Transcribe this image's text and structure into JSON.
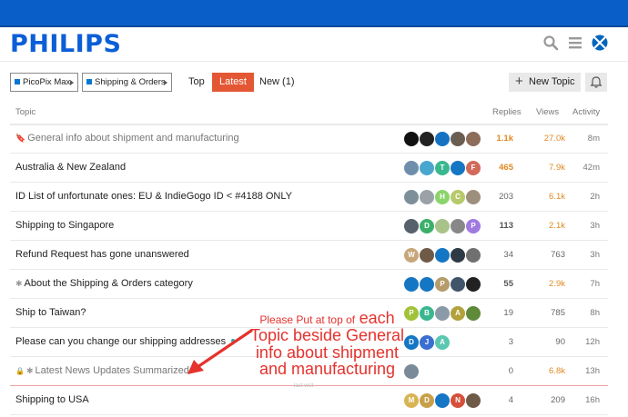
{
  "brand": {
    "logo": "PHILIPS",
    "topbar_color": "#0a5ec7",
    "accent": "#e45735"
  },
  "header": {
    "icons": [
      "search-icon",
      "menu-icon",
      "flag-icon"
    ]
  },
  "nav": {
    "crumbs": [
      {
        "label": "PicoPix Max"
      },
      {
        "label": "Shipping & Orders"
      }
    ],
    "tabs": [
      {
        "label": "Top"
      },
      {
        "label": "Latest",
        "active": true
      },
      {
        "label": "New (1)"
      }
    ],
    "new_topic": "New Topic"
  },
  "columns": {
    "topic": "Topic",
    "replies": "Replies",
    "views": "Views",
    "activity": "Activity"
  },
  "topics": [
    {
      "title": "General info about shipment and manufacturing",
      "pinned": true,
      "replies": "1.1k",
      "views": "27.0k",
      "activity": "8m",
      "avatars": [
        {
          "c": "#111111",
          "t": ""
        },
        {
          "c": "#222222",
          "t": ""
        },
        {
          "c": "#1572c2",
          "t": ""
        },
        {
          "c": "#6a5d52",
          "t": ""
        },
        {
          "c": "#8b6d5a",
          "t": ""
        }
      ]
    },
    {
      "title": "Australia & New Zealand",
      "replies": "465",
      "views": "7.9k",
      "activity": "42m",
      "avatars": [
        {
          "c": "#6f8eab",
          "t": ""
        },
        {
          "c": "#49a7cf",
          "t": ""
        },
        {
          "c": "#3ab78e",
          "t": "T"
        },
        {
          "c": "#1576c4",
          "t": ""
        },
        {
          "c": "#d16a5a",
          "t": "F"
        }
      ]
    },
    {
      "title": "ID List of unfortunate ones: EU & IndieGogo ID < #4188 ONLY",
      "replies": "203",
      "views": "6.1k",
      "activity": "2h",
      "avatars": [
        {
          "c": "#7d8f99",
          "t": ""
        },
        {
          "c": "#9aa2a8",
          "t": ""
        },
        {
          "c": "#8bd46c",
          "t": "H"
        },
        {
          "c": "#b7c96a",
          "t": "C"
        },
        {
          "c": "#9e8f7d",
          "t": ""
        }
      ]
    },
    {
      "title": "Shipping to Singapore",
      "replies": "113",
      "views": "2.1k",
      "activity": "3h",
      "avatars": [
        {
          "c": "#56616b",
          "t": ""
        },
        {
          "c": "#3cb06b",
          "t": "D"
        },
        {
          "c": "#a8c38a",
          "t": ""
        },
        {
          "c": "#888888",
          "t": ""
        },
        {
          "c": "#a07ae0",
          "t": "P"
        }
      ]
    },
    {
      "title": "Refund Request has gone unanswered",
      "replies": "34",
      "views": "763",
      "activity": "3h",
      "avatars": [
        {
          "c": "#c7a77a",
          "t": "W"
        },
        {
          "c": "#6f5a48",
          "t": ""
        },
        {
          "c": "#1576c4",
          "t": ""
        },
        {
          "c": "#2e3a46",
          "t": ""
        },
        {
          "c": "#707070",
          "t": ""
        }
      ]
    },
    {
      "title": "About the Shipping & Orders category",
      "pinned": true,
      "replies": "55",
      "views": "2.9k",
      "activity": "7h",
      "avatars": [
        {
          "c": "#1576c4",
          "t": ""
        },
        {
          "c": "#1576c4",
          "t": ""
        },
        {
          "c": "#b59c6a",
          "t": "P"
        },
        {
          "c": "#40546a",
          "t": ""
        },
        {
          "c": "#222222",
          "t": ""
        }
      ]
    },
    {
      "title": "Ship to Taiwan?",
      "replies": "19",
      "views": "785",
      "activity": "8h",
      "avatars": [
        {
          "c": "#a2c23a",
          "t": "P"
        },
        {
          "c": "#3ab78e",
          "t": "B"
        },
        {
          "c": "#8a9aa8",
          "t": ""
        },
        {
          "c": "#b3a23c",
          "t": "A"
        },
        {
          "c": "#5e8a3a",
          "t": ""
        }
      ]
    },
    {
      "title": "Please can you change our shipping addresses",
      "unread_dot": true,
      "replies": "3",
      "views": "90",
      "activity": "12h",
      "avatars": [
        {
          "c": "#1576c4",
          "t": "D"
        },
        {
          "c": "#3a6fd1",
          "t": "J"
        },
        {
          "c": "#5bc7b0",
          "t": "A"
        }
      ]
    },
    {
      "title": "Latest News Updates Summarized",
      "locked": true,
      "pinned": true,
      "muted": true,
      "replies": "0",
      "views": "6.8k",
      "activity": "13h",
      "avatars": [
        {
          "c": "#7a8a99",
          "t": ""
        }
      ],
      "last_visit": "last visit"
    },
    {
      "title": "Shipping to USA",
      "replies": "4",
      "views": "209",
      "activity": "16h",
      "avatars": [
        {
          "c": "#d8b454",
          "t": "M"
        },
        {
          "c": "#c9a04a",
          "t": "D"
        },
        {
          "c": "#1576c4",
          "t": ""
        },
        {
          "c": "#d4503a",
          "t": "N"
        },
        {
          "c": "#6f5a48",
          "t": ""
        }
      ]
    }
  ],
  "annotation": {
    "line1_small": "Please Put at top of",
    "line1_big": "each",
    "line2": "Topic beside General",
    "line3": "info about shipment",
    "line4": "and manufacturing",
    "color": "#e5322d"
  }
}
